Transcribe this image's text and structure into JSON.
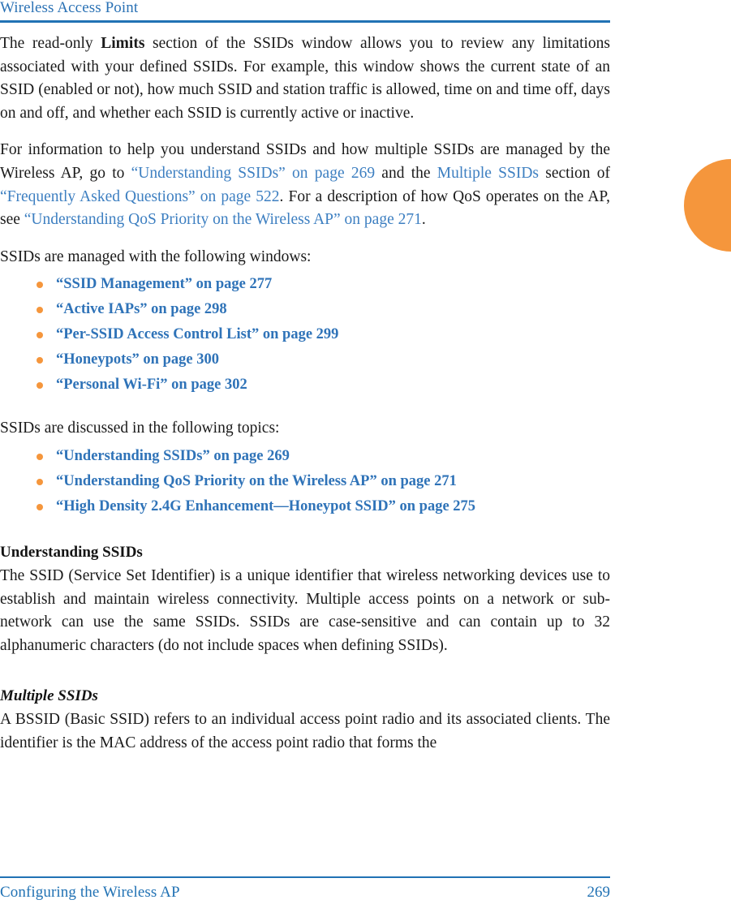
{
  "header": {
    "title": "Wireless Access Point"
  },
  "thumb_tab": {
    "name": "chapter-thumb-tab",
    "color": "#f5963c"
  },
  "colors": {
    "link_blue": "#3d7fc1",
    "heading_blue": "#2172b4",
    "accent_orange": "#f5963c",
    "body_text": "#1a1a1a"
  },
  "main": {
    "paragraph_1": {
      "part_1": "The read-only ",
      "bold_term": "Limits",
      "part_2": " section of the SSIDs window allows you to review any limitations associated with your defined SSIDs. For example, this window shows the current state of an SSID (enabled or not), how much SSID and station traffic is allowed, time on and time off, days on and off, and whether each SSID is currently active or inactive."
    },
    "paragraph_2": {
      "part_1": "For information to help you understand SSIDs and how multiple SSIDs are managed by the Wireless AP, go to ",
      "link_1": "“Understanding SSIDs” on page 269",
      "part_2": " and the ",
      "link_2": "Multiple SSIDs",
      "part_3": " section of ",
      "link_3": "“Frequently Asked Questions” on page 522",
      "part_4": ". For a description of how QoS operates on the AP, see ",
      "link_4": "“Understanding QoS Priority on the Wireless AP” on page 271",
      "part_5": "."
    },
    "lead_windows": "SSIDs are managed with the following windows:",
    "windows_list": [
      "“SSID Management” on page 277",
      "“Active IAPs” on page 298",
      "“Per-SSID Access Control List” on page 299",
      "“Honeypots” on page 300",
      "“Personal Wi-Fi” on page 302"
    ],
    "lead_topics": "SSIDs are discussed in the following topics:",
    "topics_list": [
      "“Understanding SSIDs” on page 269",
      "“Understanding QoS Priority on the Wireless AP” on page 271",
      "“High Density 2.4G Enhancement—Honeypot SSID” on page 275"
    ],
    "section_understanding": {
      "heading": "Understanding SSIDs",
      "body": "The SSID (Service Set Identifier) is a unique identifier that wireless networking devices use to establish and maintain wireless connectivity. Multiple access points on a network or sub-network can use the same SSIDs. SSIDs are case-sensitive and can contain up to 32 alphanumeric characters (do not include spaces when defining SSIDs)."
    },
    "section_multiple": {
      "heading": "Multiple SSIDs",
      "body": "A BSSID (Basic SSID) refers to an individual access point radio and its associated clients. The identifier is the MAC address of the access point radio that forms the"
    }
  },
  "footer": {
    "chapter": "Configuring the Wireless AP",
    "page_number": "269"
  }
}
